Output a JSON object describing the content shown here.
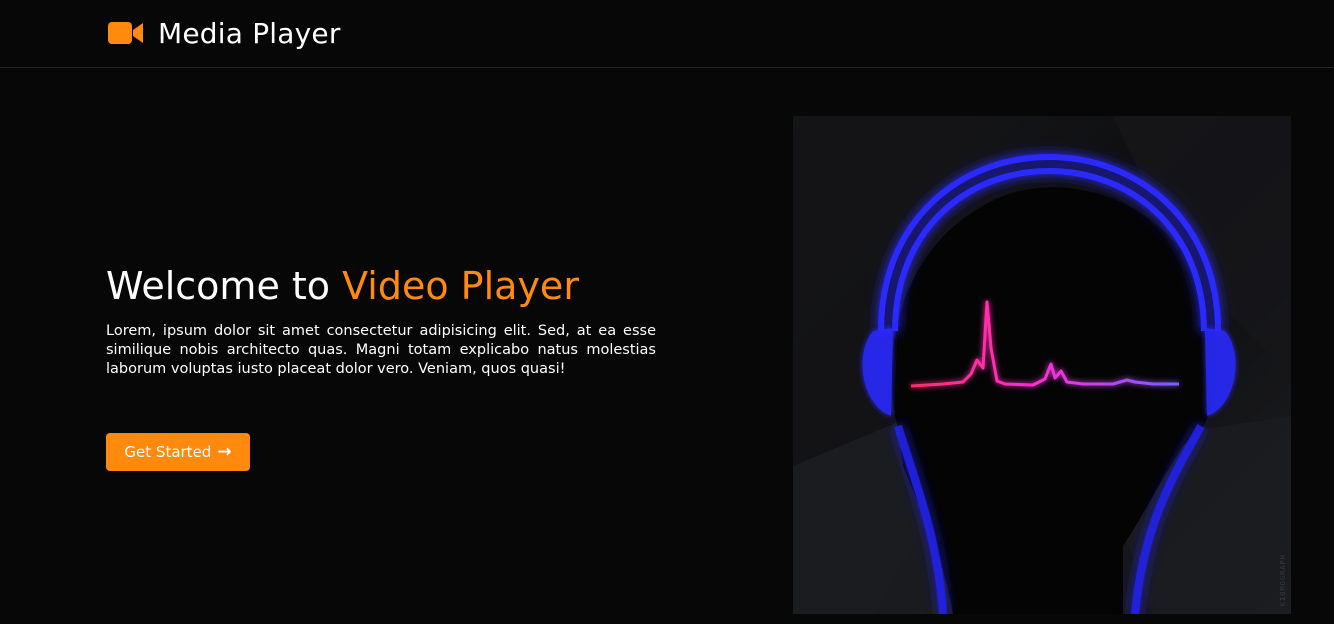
{
  "header": {
    "brand_icon": "video-camera-icon",
    "title": "Media Player"
  },
  "hero": {
    "title_prefix": "Welcome to ",
    "title_highlight": "Video Player",
    "description": "Lorem, ipsum dolor sit amet consectetur adipisicing elit. Sed, at ea esse similique nobis architecto quas. Magni totam explicabo natus molestias laborum voluptas iusto placeat dolor vero. Veniam, quos quasi!",
    "cta_label": "Get Started",
    "cta_icon": "arrow-right-icon"
  },
  "artwork": {
    "subject": "headphones-waveform-illustration",
    "watermark": "KIOMOGRAPH"
  },
  "colors": {
    "background": "#070707",
    "accent": "#ff8a0d",
    "text": "#ffffff",
    "headphone_glow": "#2a2cff",
    "wave_start": "#ff2d6e",
    "wave_end": "#7a5cff"
  }
}
